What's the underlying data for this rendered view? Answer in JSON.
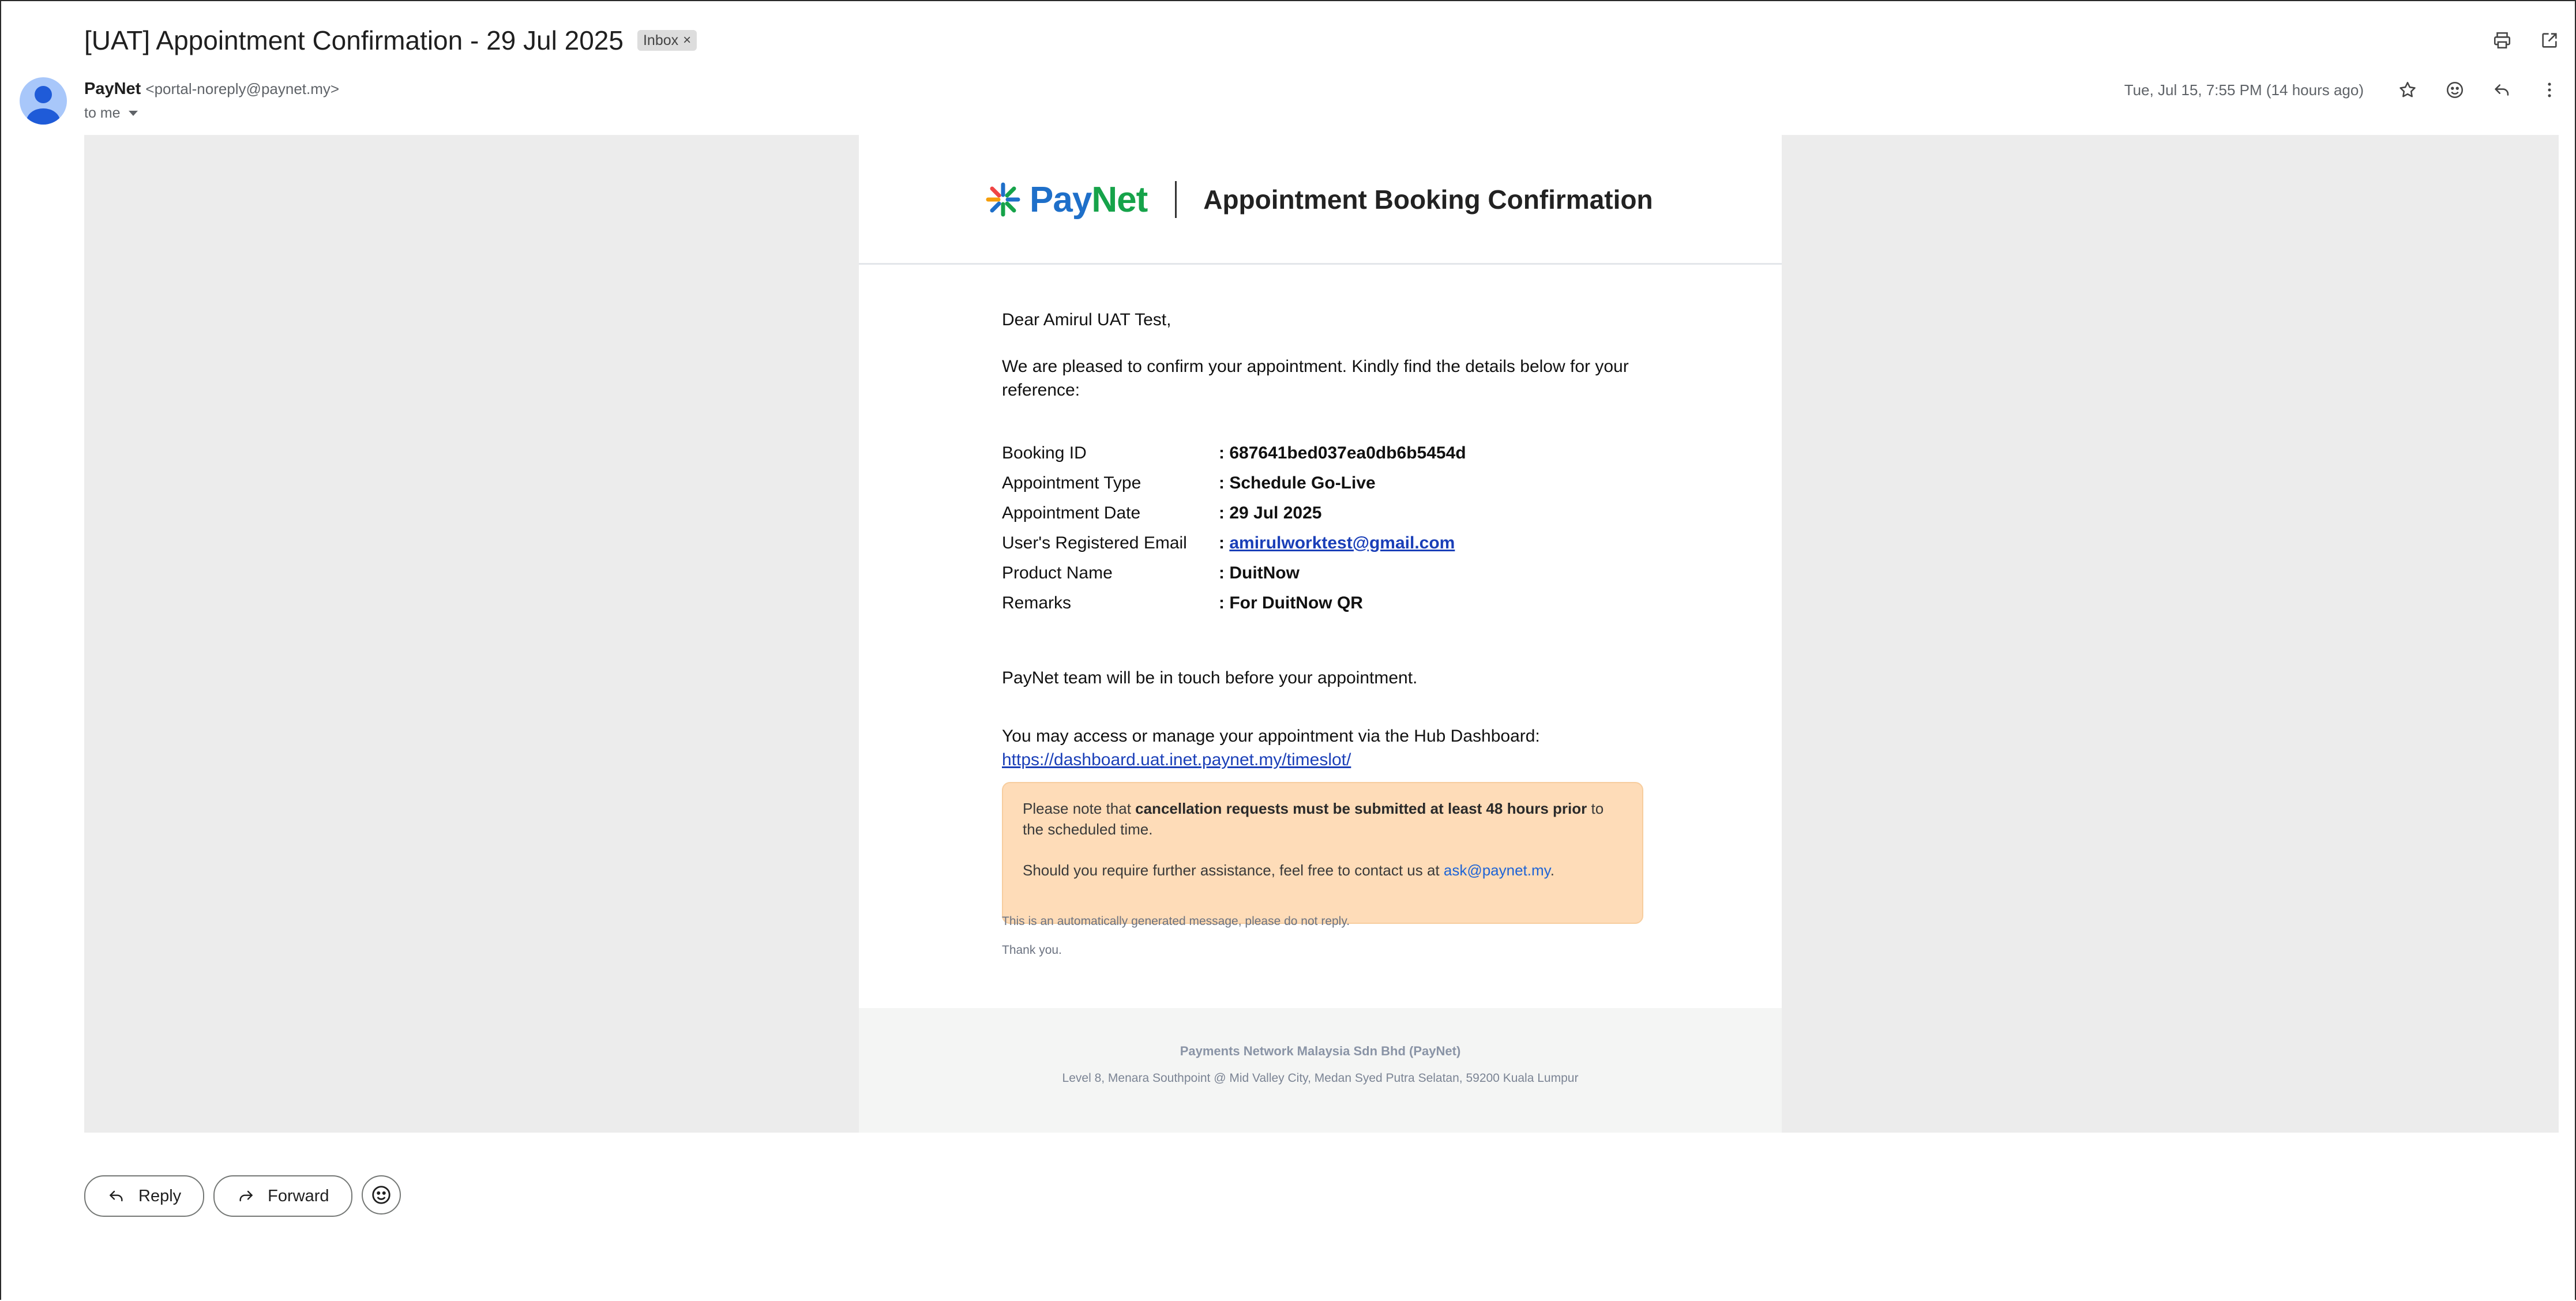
{
  "email": {
    "subject": "[UAT] Appointment Confirmation - 29 Jul 2025",
    "label": "Inbox",
    "label_remove": "×",
    "sender_name": "PayNet",
    "sender_email": "<portal-noreply@paynet.my>",
    "to": "to me",
    "date": "Tue, Jul 15, 7:55 PM (14 hours ago)"
  },
  "icons": {
    "print": "printer-icon",
    "new_window": "open-in-new-icon",
    "star": "star-icon",
    "emoji": "emoji-icon",
    "reply": "reply-icon",
    "more": "more-vert-icon"
  },
  "message": {
    "brand_pay": "Pay",
    "brand_net": "Net",
    "header_title": "Appointment Booking Confirmation",
    "greeting": "Dear Amirul UAT Test,",
    "intro": "We are pleased to confirm your appointment. Kindly find the details below for your reference:",
    "details": [
      {
        "label": "Booking ID",
        "value": ": 687641bed037ea0db6b5454d"
      },
      {
        "label": "Appointment Type",
        "value": ": Schedule Go-Live"
      },
      {
        "label": "Appointment Date",
        "value": ": 29 Jul 2025"
      },
      {
        "label": "User's Registered Email",
        "sep": ": ",
        "value": "amirulworktest@gmail.com"
      },
      {
        "label": "Product Name",
        "value": ": DuitNow"
      },
      {
        "label": "Remarks",
        "value": ": For DuitNow QR"
      }
    ],
    "touch": "PayNet team will be in touch before your appointment.",
    "access": "You may access or manage your appointment via the Hub Dashboard:",
    "dashboard_link": "https://dashboard.uat.inet.paynet.my/timeslot/",
    "notice_pre": "Please note that ",
    "notice_bold": "cancellation requests must be submitted at least 48 hours prior",
    "notice_post": " to the scheduled time.",
    "notice_help": "Should you require further assistance, feel free to contact us at ",
    "notice_email": "ask@paynet.my",
    "notice_end": ".",
    "auto": "This is an automatically generated message, please do not reply.",
    "thanks": "Thank you.",
    "footer_company": "Payments Network Malaysia Sdn Bhd (PayNet)",
    "footer_address": "Level 8, Menara Southpoint @ Mid Valley City, Medan Syed Putra Selatan, 59200 Kuala Lumpur"
  },
  "actions": {
    "reply": "Reply",
    "forward": "Forward"
  },
  "colors": {
    "brand_blue": "#1e6fc9",
    "brand_green": "#16a34a",
    "notice_bg": "#fedcb8",
    "link": "#1a3fb8"
  }
}
